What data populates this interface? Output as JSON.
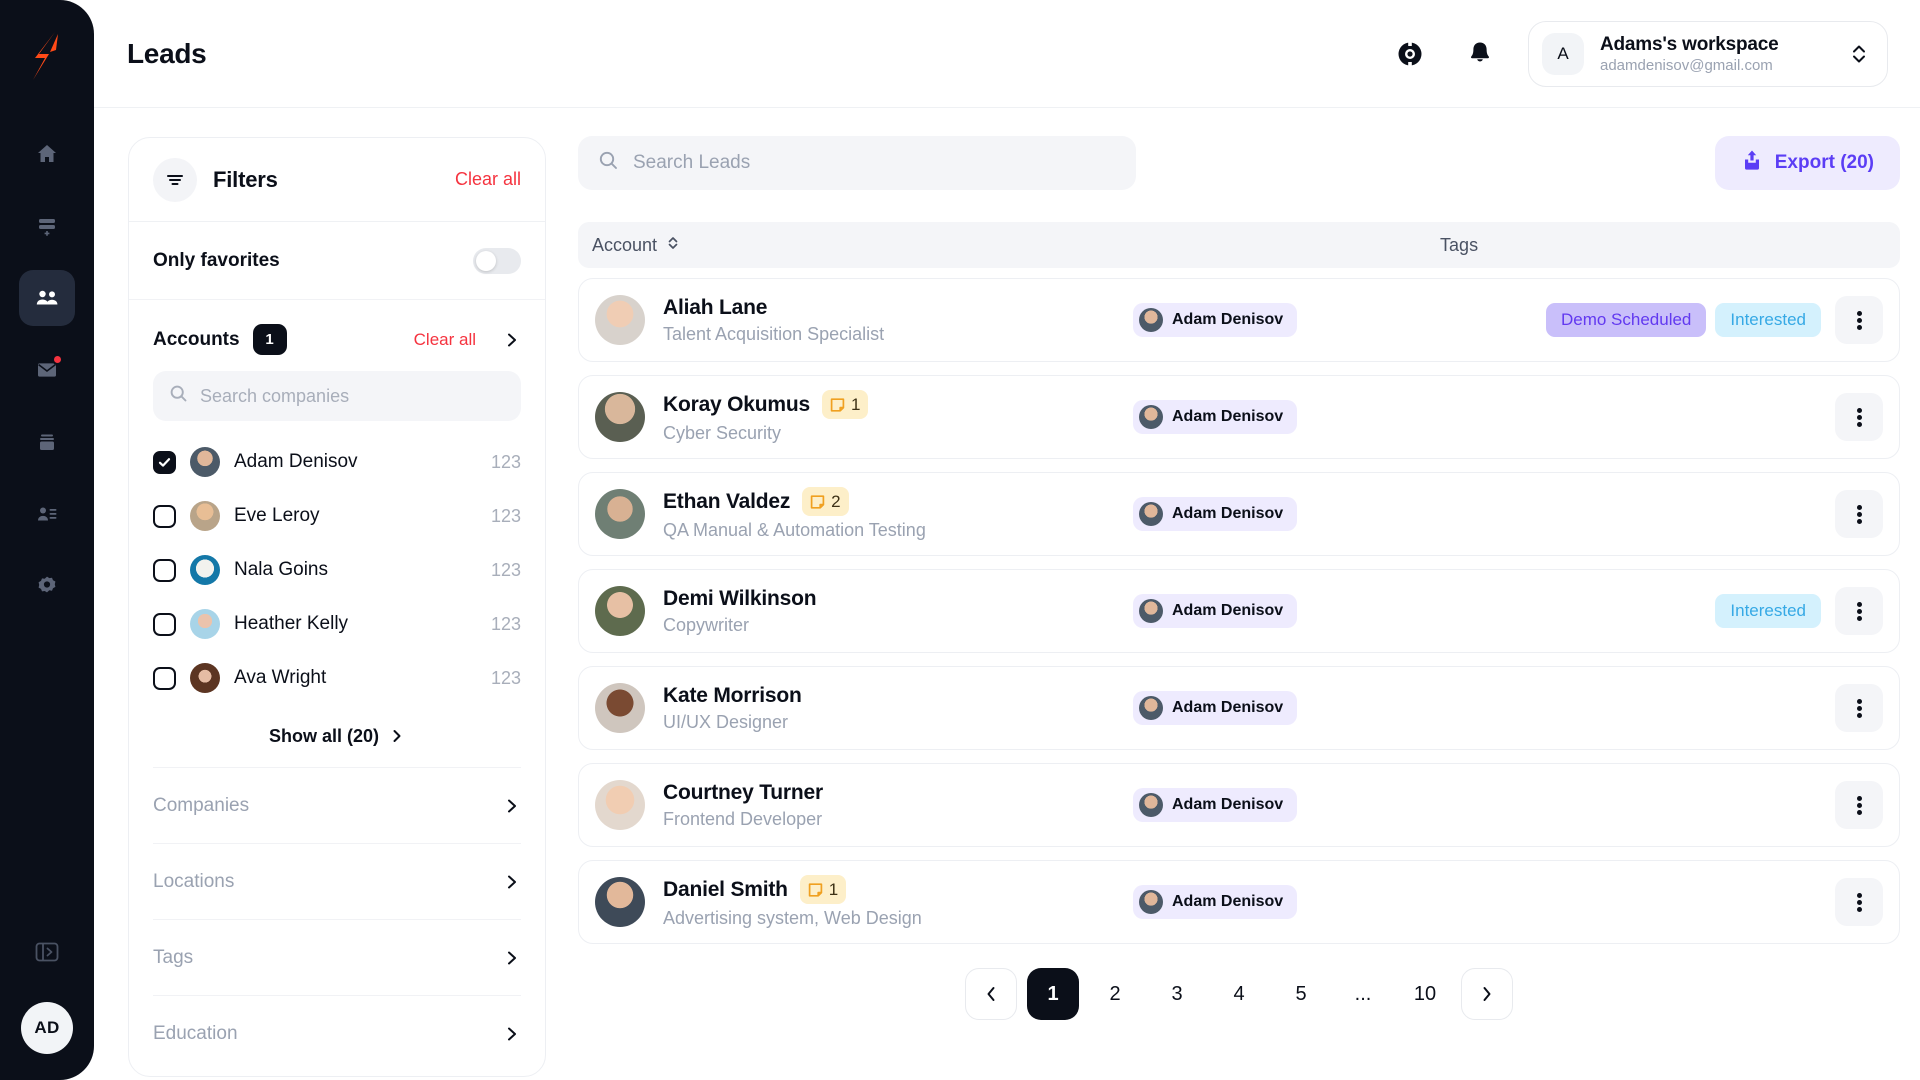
{
  "app": {
    "logo_icon": "lightning-bolt-logo",
    "accent_orange": "#FF4A17",
    "rail_bg": "#0B0F19"
  },
  "rail": {
    "items": [
      {
        "icon": "home-icon",
        "name": "home",
        "active": false,
        "badge": false
      },
      {
        "icon": "add-list-icon",
        "name": "campaigns",
        "active": false,
        "badge": false
      },
      {
        "icon": "people-icon",
        "name": "leads",
        "active": true,
        "badge": false
      },
      {
        "icon": "mail-icon",
        "name": "inbox",
        "active": false,
        "badge": true
      },
      {
        "icon": "archive-icon",
        "name": "archive",
        "active": false,
        "badge": false
      },
      {
        "icon": "contact-list-icon",
        "name": "contacts",
        "active": false,
        "badge": false
      },
      {
        "icon": "gear-icon",
        "name": "settings",
        "active": false,
        "badge": false
      }
    ],
    "collapse_icon": "panel-expand-icon",
    "avatar_initials": "AD"
  },
  "header": {
    "title": "Leads",
    "help_icon": "lifebuoy-icon",
    "notifications_icon": "bell-icon",
    "workspace": {
      "avatar_initial": "A",
      "name": "Adams's workspace",
      "email": "adamdenisov@gmail.com",
      "caret_icon": "chevron-up-down-icon"
    }
  },
  "filters": {
    "icon": "filter-icon",
    "title": "Filters",
    "clear_all": "Clear all",
    "only_favorites": {
      "label": "Only favorites",
      "enabled": false
    },
    "accounts": {
      "label": "Accounts",
      "count": "1",
      "clear_all": "Clear all",
      "search_placeholder": "Search companies",
      "search_value": "",
      "items": [
        {
          "name": "Adam Denisov",
          "count": "123",
          "checked": true
        },
        {
          "name": "Eve Leroy",
          "count": "123",
          "checked": false
        },
        {
          "name": "Nala Goins",
          "count": "123",
          "checked": false
        },
        {
          "name": "Heather Kelly",
          "count": "123",
          "checked": false
        },
        {
          "name": "Ava Wright",
          "count": "123",
          "checked": false
        }
      ],
      "show_all": "Show all (20)"
    },
    "sections": [
      {
        "label": "Companies"
      },
      {
        "label": "Locations"
      },
      {
        "label": "Tags"
      },
      {
        "label": "Education"
      }
    ]
  },
  "toolbar": {
    "search_placeholder": "Search Leads",
    "search_value": "",
    "search_icon": "search-icon",
    "export_label": "Export (20)",
    "export_icon": "upload-icon",
    "export_bg": "#EEEBFE",
    "export_fg": "#5B3DF5"
  },
  "table": {
    "columns": {
      "account": "Account",
      "tags": "Tags"
    },
    "sort_icon": "sort-chevrons-icon",
    "rows": [
      {
        "name": "Aliah Lane",
        "role": "Talent Acquisition Specialist",
        "notes": null,
        "assignee": "Adam Denisov",
        "tags": [
          {
            "label": "Demo Scheduled",
            "bg": "#C9BFFA",
            "fg": "#6239F0"
          },
          {
            "label": "Interested",
            "bg": "#D4F1FD",
            "fg": "#36A9E5"
          }
        ]
      },
      {
        "name": "Koray Okumus",
        "role": "Cyber Security",
        "notes": "1",
        "assignee": "Adam Denisov",
        "tags": []
      },
      {
        "name": "Ethan Valdez",
        "role": "QA Manual & Automation Testing",
        "notes": "2",
        "assignee": "Adam Denisov",
        "tags": []
      },
      {
        "name": "Demi Wilkinson",
        "role": "Copywriter",
        "notes": null,
        "assignee": "Adam Denisov",
        "tags": [
          {
            "label": "Interested",
            "bg": "#D4F1FD",
            "fg": "#36A9E5"
          }
        ]
      },
      {
        "name": "Kate Morrison",
        "role": "UI/UX Designer",
        "notes": null,
        "assignee": "Adam Denisov",
        "tags": []
      },
      {
        "name": "Courtney Turner",
        "role": "Frontend Developer",
        "notes": null,
        "assignee": "Adam Denisov",
        "tags": []
      },
      {
        "name": "Daniel Smith",
        "role": "Advertising system, Web Design",
        "notes": "1",
        "assignee": "Adam Denisov",
        "tags": []
      }
    ],
    "row_menu_icon": "kebab-menu-icon"
  },
  "pagination": {
    "prev_icon": "chevron-left-icon",
    "next_icon": "chevron-right-icon",
    "pages": [
      "1",
      "2",
      "3",
      "4",
      "5",
      "...",
      "10"
    ],
    "current": "1"
  }
}
